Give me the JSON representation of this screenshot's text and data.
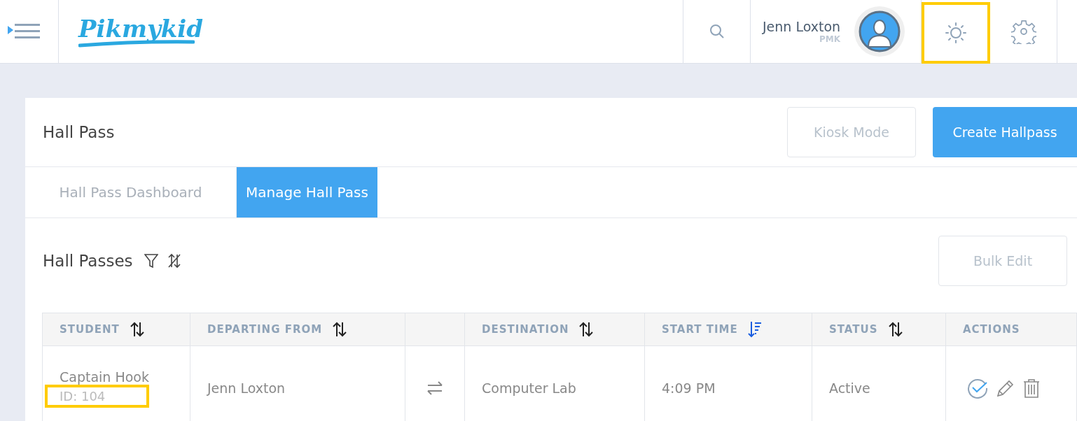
{
  "header": {
    "logo": "Pikmykid",
    "user": {
      "name": "Jenn Loxton",
      "role": "PMK"
    },
    "theme_button": {
      "highlighted": true
    }
  },
  "page": {
    "title": "Hall Pass",
    "buttons": [
      {
        "label": "Kiosk Mode",
        "kind": "outline"
      },
      {
        "label": "Create Hallpass",
        "kind": "primary"
      }
    ]
  },
  "tabs": [
    {
      "label": "Hall Pass Dashboard",
      "selected": false
    },
    {
      "label": "Manage Hall Pass",
      "selected": true
    }
  ],
  "section": {
    "title": "Hall Passes",
    "bulk_button": "Bulk Edit"
  },
  "table": {
    "columns": [
      {
        "label": "STUDENT",
        "kind": "sortable"
      },
      {
        "label": "DEPARTING FROM",
        "kind": "sortable"
      },
      {
        "kind": "plain"
      },
      {
        "label": "DESTINATION",
        "kind": "sortable"
      },
      {
        "label": "START TIME",
        "kind": "sorted"
      },
      {
        "label": "STATUS",
        "kind": "sortable"
      },
      {
        "label": "ACTIONS",
        "kind": "plain"
      }
    ],
    "rows": [
      {
        "student": "Captain Hook",
        "id": "ID: 104",
        "id_highlighted": true,
        "departing": "Jenn Loxton",
        "destination": "Computer Lab",
        "start_time": "4:09 PM",
        "status": "Active"
      }
    ]
  }
}
